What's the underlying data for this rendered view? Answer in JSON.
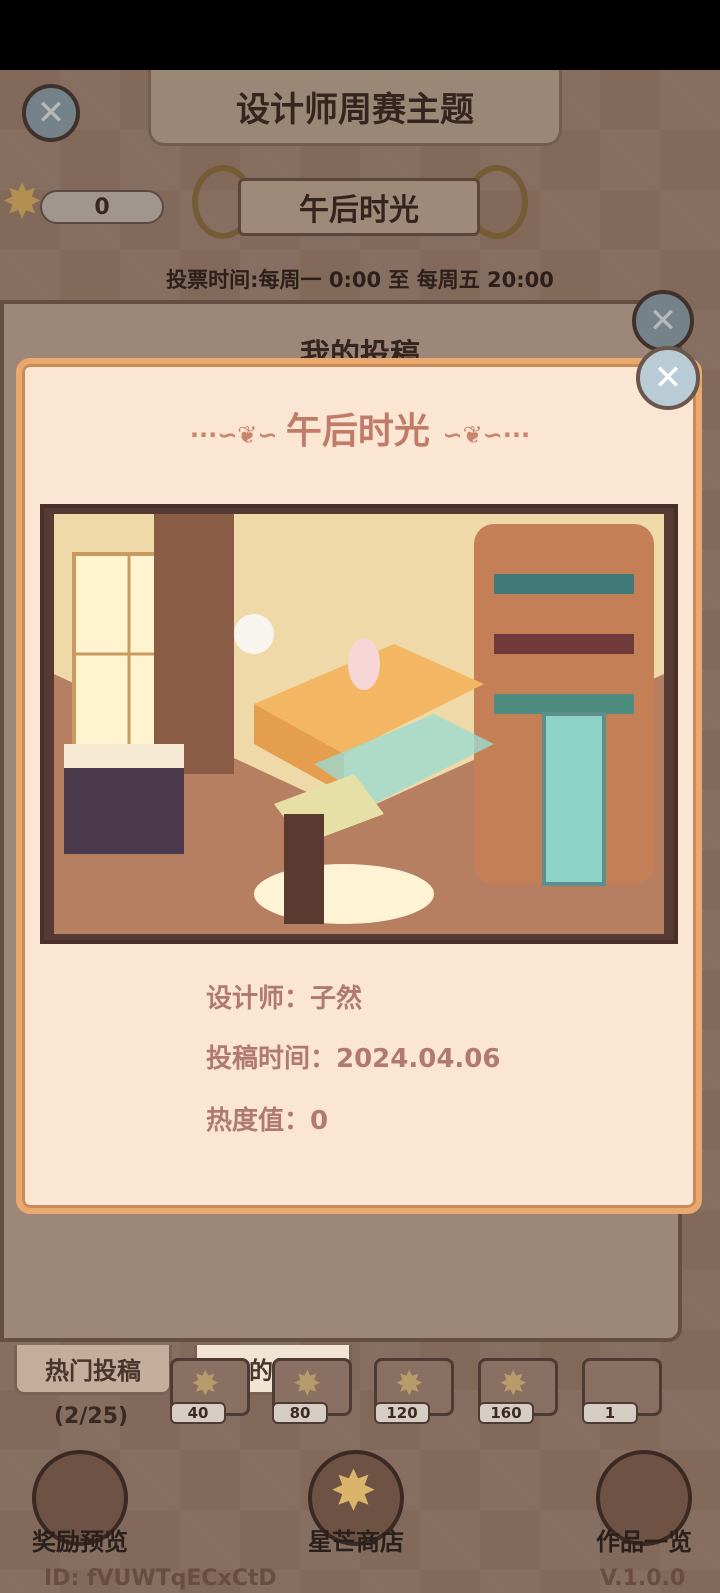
{
  "header": {
    "title": "设计师周赛主题",
    "theme_name": "午后时光",
    "star_count": "0",
    "vote_time": "投票时间:每周一  0:00  至  每周五  20:00"
  },
  "back_panel": {
    "title": "我的投稿"
  },
  "modal": {
    "title": "午后时光",
    "designer_label": "设计师：子然",
    "submit_time_label": "投稿时间：2024.04.06",
    "heat_label": "热度值：0"
  },
  "tabs": {
    "hot": "热门投稿",
    "mine": "我的投稿",
    "progress": "(2/25)"
  },
  "rewards": [
    "40",
    "80",
    "120",
    "160",
    "1"
  ],
  "bottom_nav": {
    "reward_preview": "奖励预览",
    "star_shop": "星芒商店",
    "works": "作品一览"
  },
  "footer": {
    "user_id": "ID: fVUWTqECxCtD",
    "version": "V.1.0.0"
  },
  "icons": {
    "close": "close-x-icon",
    "star": "star-icon",
    "sofa_room": "room-illustration"
  },
  "colors": {
    "modal_bg": "#fae6d2",
    "modal_border": "#e8a86e",
    "accent_text": "#c17b69",
    "info_text": "#b17a70"
  }
}
